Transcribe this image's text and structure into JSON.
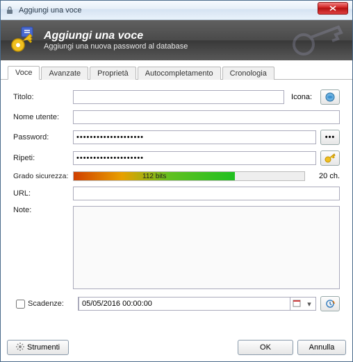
{
  "window": {
    "title": "Aggiungi una voce"
  },
  "header": {
    "title": "Aggiungi una voce",
    "subtitle": "Aggiungi una nuova password al database"
  },
  "tabs": [
    {
      "label": "Voce",
      "active": true
    },
    {
      "label": "Avanzate"
    },
    {
      "label": "Proprietà"
    },
    {
      "label": "Autocompletamento"
    },
    {
      "label": "Cronologia"
    }
  ],
  "fields": {
    "title_label": "Titolo:",
    "title_value": "",
    "icon_label": "Icona:",
    "username_label": "Nome utente:",
    "username_value": "",
    "password_label": "Password:",
    "password_value": "••••••••••••••••••••",
    "repeat_label": "Ripeti:",
    "repeat_value": "••••••••••••••••••••",
    "strength_label": "Grado sicurezza:",
    "strength_text": "112 bits",
    "strength_chars": "20 ch.",
    "url_label": "URL:",
    "url_value": "",
    "notes_label": "Note:",
    "notes_value": "",
    "expiry_label": "Scadenze:",
    "expiry_value": "05/05/2016 00:00:00",
    "expiry_checked": false
  },
  "buttons": {
    "tools": "Strumenti",
    "ok": "OK",
    "cancel": "Annulla",
    "show_password": "•••"
  }
}
